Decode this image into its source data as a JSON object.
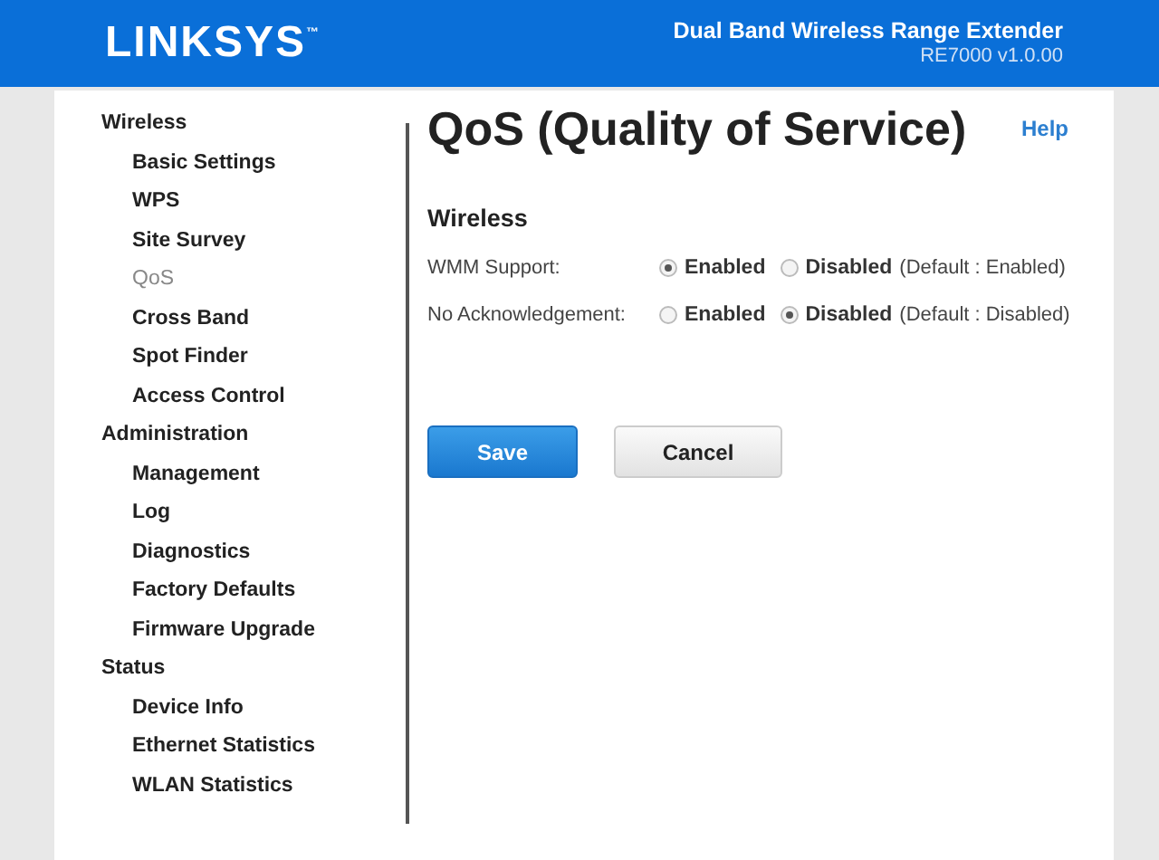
{
  "header": {
    "logo": "LINKSYS",
    "logo_mark": "™",
    "product": "Dual Band Wireless Range Extender",
    "model": "RE7000 v1.0.00"
  },
  "sidebar": {
    "sections": [
      {
        "label": "Wireless",
        "items": [
          {
            "label": "Basic Settings",
            "selected": false
          },
          {
            "label": "WPS",
            "selected": false
          },
          {
            "label": "Site Survey",
            "selected": false
          },
          {
            "label": "QoS",
            "selected": true
          },
          {
            "label": "Cross Band",
            "selected": false
          },
          {
            "label": "Spot Finder",
            "selected": false
          },
          {
            "label": "Access Control",
            "selected": false
          }
        ]
      },
      {
        "label": "Administration",
        "items": [
          {
            "label": "Management",
            "selected": false
          },
          {
            "label": "Log",
            "selected": false
          },
          {
            "label": "Diagnostics",
            "selected": false
          },
          {
            "label": "Factory Defaults",
            "selected": false
          },
          {
            "label": "Firmware Upgrade",
            "selected": false
          }
        ]
      },
      {
        "label": "Status",
        "items": [
          {
            "label": "Device Info",
            "selected": false
          },
          {
            "label": "Ethernet Statistics",
            "selected": false
          },
          {
            "label": "WLAN Statistics",
            "selected": false
          }
        ]
      }
    ]
  },
  "main": {
    "title": "QoS (Quality of Service)",
    "help": "Help",
    "section": "Wireless",
    "settings": [
      {
        "label": "WMM Support:",
        "options": [
          {
            "label": "Enabled",
            "selected": true
          },
          {
            "label": "Disabled",
            "selected": false
          }
        ],
        "default": "(Default : Enabled)"
      },
      {
        "label": "No Acknowledgement:",
        "options": [
          {
            "label": "Enabled",
            "selected": false
          },
          {
            "label": "Disabled",
            "selected": true
          }
        ],
        "default": "(Default : Disabled)"
      }
    ],
    "buttons": [
      {
        "label": "Save",
        "kind": "primary"
      },
      {
        "label": "Cancel",
        "kind": "secondary"
      }
    ]
  }
}
